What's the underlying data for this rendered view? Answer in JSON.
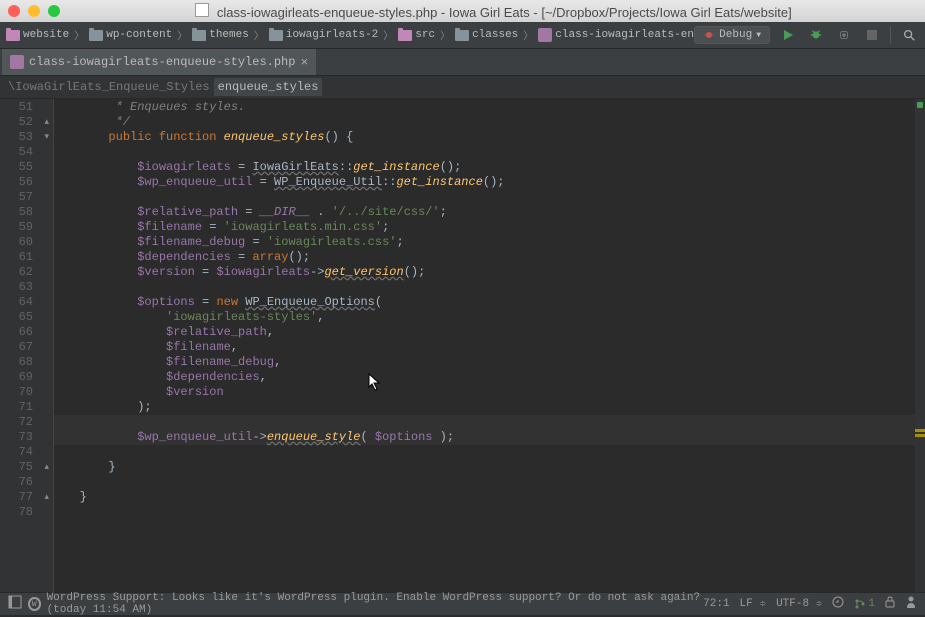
{
  "window": {
    "title": "class-iowagirleats-enqueue-styles.php - Iowa Girl Eats - [~/Dropbox/Projects/Iowa Girl Eats/website]"
  },
  "breadcrumbs": {
    "items": [
      {
        "icon": "folder-purple",
        "label": "website"
      },
      {
        "icon": "folder",
        "label": "wp-content"
      },
      {
        "icon": "folder",
        "label": "themes"
      },
      {
        "icon": "folder",
        "label": "iowagirleats-2"
      },
      {
        "icon": "folder-purple",
        "label": "src"
      },
      {
        "icon": "folder",
        "label": "classes"
      },
      {
        "icon": "php",
        "label": "class-iowagirleats-enqueue-styles.php"
      }
    ]
  },
  "run_config": "Debug",
  "tab": {
    "label": "class-iowagirleats-enqueue-styles.php"
  },
  "sub_breadcrumb": {
    "class": "\\IowaGirlEats_Enqueue_Styles",
    "method": "enqueue_styles"
  },
  "lines": [
    {
      "n": 51,
      "html": "        <span class='tok-comment'>* Enqueues styles.</span>"
    },
    {
      "n": 52,
      "html": "        <span class='tok-comment'>*/</span>",
      "fold": "up"
    },
    {
      "n": 53,
      "html": "       <span class='tok-keyword'>public function </span><span class='tok-method'>enqueue_styles</span>() {",
      "fold": "down"
    },
    {
      "n": 54,
      "html": ""
    },
    {
      "n": 55,
      "html": "           <span class='tok-var'>$iowagirleats</span> = <span class='tok-class'>IowaGirlEats</span>::<span class='tok-method'>get_instance</span>();"
    },
    {
      "n": 56,
      "html": "           <span class='tok-var'>$wp_enqueue_util</span> = <span class='tok-class'>WP_Enqueue_Util</span>::<span class='tok-method'>get_instance</span>();"
    },
    {
      "n": 57,
      "html": ""
    },
    {
      "n": 58,
      "html": "           <span class='tok-var'>$relative_path</span> = <span class='tok-const'>__DIR__</span> . <span class='tok-string'>'/../site/css/'</span>;"
    },
    {
      "n": 59,
      "html": "           <span class='tok-var'>$filename</span> = <span class='tok-string'>'iowagirleats.min.css'</span>;"
    },
    {
      "n": 60,
      "html": "           <span class='tok-var'>$filename_debug</span> = <span class='tok-string'>'iowagirleats.css'</span>;"
    },
    {
      "n": 61,
      "html": "           <span class='tok-var'>$dependencies</span> = <span class='tok-keyword'>array</span>();"
    },
    {
      "n": 62,
      "html": "           <span class='tok-var'>$version</span> = <span class='tok-var'>$iowagirleats</span>-><span class='tok-method-ul'>get_version</span>();"
    },
    {
      "n": 63,
      "html": ""
    },
    {
      "n": 64,
      "html": "           <span class='tok-var'>$options</span> = <span class='tok-new'>new </span><span class='tok-class'>WP_Enqueue_Options</span>("
    },
    {
      "n": 65,
      "html": "               <span class='tok-string'>'iowagirleats-styles'</span>,"
    },
    {
      "n": 66,
      "html": "               <span class='tok-var'>$relative_path</span>,"
    },
    {
      "n": 67,
      "html": "               <span class='tok-var'>$filename</span>,"
    },
    {
      "n": 68,
      "html": "               <span class='tok-var'>$filename_debug</span>,"
    },
    {
      "n": 69,
      "html": "               <span class='tok-var'>$dependencies</span>,"
    },
    {
      "n": 70,
      "html": "               <span class='tok-var'>$version</span>"
    },
    {
      "n": 71,
      "html": "           );"
    },
    {
      "n": 72,
      "html": "",
      "hl": true
    },
    {
      "n": 73,
      "html": "           <span class='tok-var'>$wp_enqueue_util</span>-><span class='tok-method-ul'>enqueue_style</span>( <span class='tok-var'>$options</span> );",
      "hl": true
    },
    {
      "n": 74,
      "html": ""
    },
    {
      "n": 75,
      "html": "       }",
      "fold": "up"
    },
    {
      "n": 76,
      "html": ""
    },
    {
      "n": 77,
      "html": "   }",
      "fold": "up"
    },
    {
      "n": 78,
      "html": ""
    }
  ],
  "statusbar": {
    "message": "WordPress Support: Looks like it's WordPress plugin. Enable WordPress support? Or do not ask again? (today 11:54 AM)",
    "pos": "72:1",
    "line_sep": "LF",
    "encoding": "UTF-8",
    "git": "1"
  }
}
